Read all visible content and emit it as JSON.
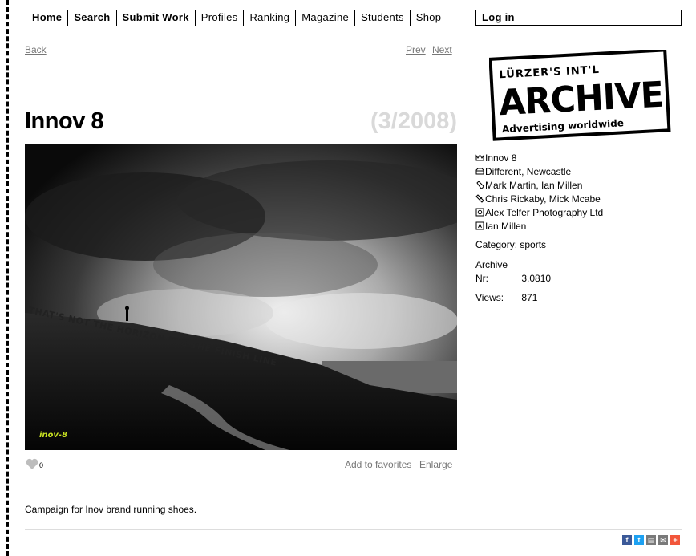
{
  "nav": {
    "items": [
      "Home",
      "Search",
      "Submit Work",
      "Profiles",
      "Ranking",
      "Magazine",
      "Students",
      "Shop"
    ],
    "login": "Log in"
  },
  "pager": {
    "back": "Back",
    "prev": "Prev",
    "next": "Next"
  },
  "work": {
    "title": "Innov 8",
    "issue": "(3/2008)",
    "headline_in_image": "THAT'S NOT THE HORIZON IT'S THE FINISH LINE",
    "brand_in_image": "inov-8",
    "likes": "0",
    "add_favorites": "Add to favorites",
    "enlarge": "Enlarge",
    "description": "Campaign for Inov brand running shoes."
  },
  "logo": {
    "line1": "LÜRZER'S INT'L",
    "line2": "ARCHIVE",
    "line3": "Advertising worldwide"
  },
  "credits": [
    {
      "icon": "crown-icon",
      "text": "Innov 8"
    },
    {
      "icon": "agency-icon",
      "text": "Different, Newcastle"
    },
    {
      "icon": "pen-icon",
      "text": "Mark Martin, Ian Millen"
    },
    {
      "icon": "brush-icon",
      "text": "Chris Rickaby, Mick Mcabe"
    },
    {
      "icon": "camera-icon",
      "text": "Alex Telfer Photography Ltd"
    },
    {
      "icon": "text-icon",
      "text": "Ian Millen"
    }
  ],
  "meta": {
    "category_label": "Category:",
    "category_value": "sports",
    "archive_label": "Archive",
    "nr_label": "Nr:",
    "nr_value": "3.0810",
    "views_label": "Views:",
    "views_value": "871"
  },
  "share": [
    {
      "icon": "facebook-icon",
      "glyph": "f",
      "color": "#3b5998"
    },
    {
      "icon": "twitter-icon",
      "glyph": "t",
      "color": "#1da1f2"
    },
    {
      "icon": "print-icon",
      "glyph": "▤",
      "color": "#7a7a7a"
    },
    {
      "icon": "email-icon",
      "glyph": "✉",
      "color": "#7a7a7a"
    },
    {
      "icon": "plus-icon",
      "glyph": "+",
      "color": "#f2563b"
    }
  ]
}
